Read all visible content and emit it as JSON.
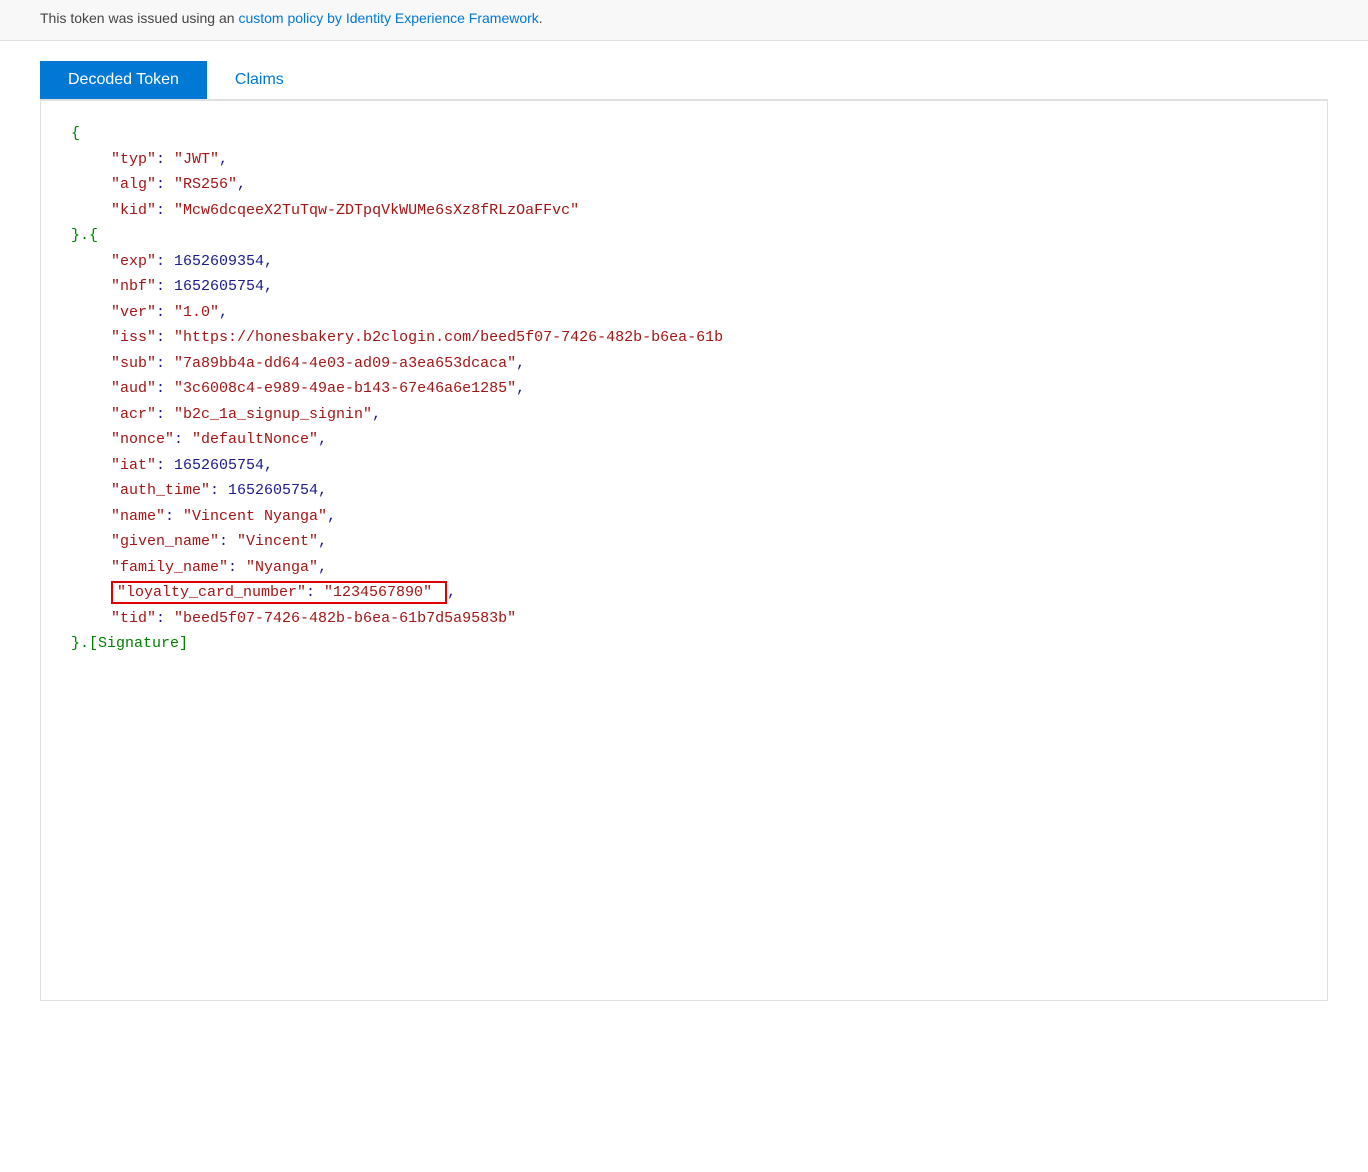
{
  "topNotice": {
    "text": "This token was issued using an ",
    "linkText": "custom policy by Identity Experience Framework",
    "linkHref": "#",
    "textAfter": "."
  },
  "tabs": {
    "active": "Decoded Token",
    "inactive": "Claims"
  },
  "jsonContent": {
    "header": {
      "open": "{",
      "fields": [
        {
          "key": "\"typ\"",
          "colon": ": ",
          "value": "\"JWT\"",
          "comma": ","
        },
        {
          "key": "\"alg\"",
          "colon": ": ",
          "value": "\"RS256\"",
          "comma": ","
        },
        {
          "key": "\"kid\"",
          "colon": ": ",
          "value": "\"Mcw6dcqeeX2TuTqw-ZDTpqVkWUMe6sXz8fRLzOaFFvc\"",
          "comma": ""
        }
      ],
      "close": "}."
    },
    "payload": {
      "open": "{",
      "fields": [
        {
          "key": "\"exp\"",
          "colon": ": ",
          "value": "1652609354",
          "comma": ",",
          "type": "number"
        },
        {
          "key": "\"nbf\"",
          "colon": ": ",
          "value": "1652605754",
          "comma": ",",
          "type": "number"
        },
        {
          "key": "\"ver\"",
          "colon": ": ",
          "value": "\"1.0\"",
          "comma": ",",
          "type": "string"
        },
        {
          "key": "\"iss\"",
          "colon": ": ",
          "value": "\"https://honesbakery.b2clogin.com/beed5f07-7426-482b-b6ea-61b",
          "comma": "",
          "type": "string",
          "truncated": true
        },
        {
          "key": "\"sub\"",
          "colon": ": ",
          "value": "\"7a89bb4a-dd64-4e03-ad09-a3ea653dcaca\"",
          "comma": ",",
          "type": "string"
        },
        {
          "key": "\"aud\"",
          "colon": ": ",
          "value": "\"3c6008c4-e989-49ae-b143-67e46a6e1285\"",
          "comma": ",",
          "type": "string"
        },
        {
          "key": "\"acr\"",
          "colon": ": ",
          "value": "\"b2c_1a_signup_signin\"",
          "comma": ",",
          "type": "string"
        },
        {
          "key": "\"nonce\"",
          "colon": ": ",
          "value": "\"defaultNonce\"",
          "comma": ",",
          "type": "string"
        },
        {
          "key": "\"iat\"",
          "colon": ": ",
          "value": "1652605754",
          "comma": ",",
          "type": "number"
        },
        {
          "key": "\"auth_time\"",
          "colon": ": ",
          "value": "1652605754",
          "comma": ",",
          "type": "number"
        },
        {
          "key": "\"name\"",
          "colon": ": ",
          "value": "\"Vincent Nyanga\"",
          "comma": ",",
          "type": "string"
        },
        {
          "key": "\"given_name\"",
          "colon": ": ",
          "value": "\"Vincent\"",
          "comma": ",",
          "type": "string"
        },
        {
          "key": "\"family_name\"",
          "colon": ": ",
          "value": "\"Nyanga\"",
          "comma": ",",
          "type": "string"
        },
        {
          "key": "\"loyalty_card_number\"",
          "colon": ": ",
          "value": "\"1234567890\"",
          "comma": ",",
          "type": "string",
          "highlighted": true
        },
        {
          "key": "\"tid\"",
          "colon": ": ",
          "value": "\"beed5f07-7426-482b-b6ea-61b7d5a9583b\"",
          "comma": "",
          "type": "string"
        }
      ],
      "close": "}."
    },
    "signature": "[Signature]"
  },
  "colors": {
    "activeTab": "#0078d4",
    "inactiveTab": "#0078d4",
    "keyColor": "#a31515",
    "numberColor": "#1a1a8c",
    "braceColor": "#008000",
    "signatureColor": "#008000",
    "highlightBorder": "#e00000"
  }
}
